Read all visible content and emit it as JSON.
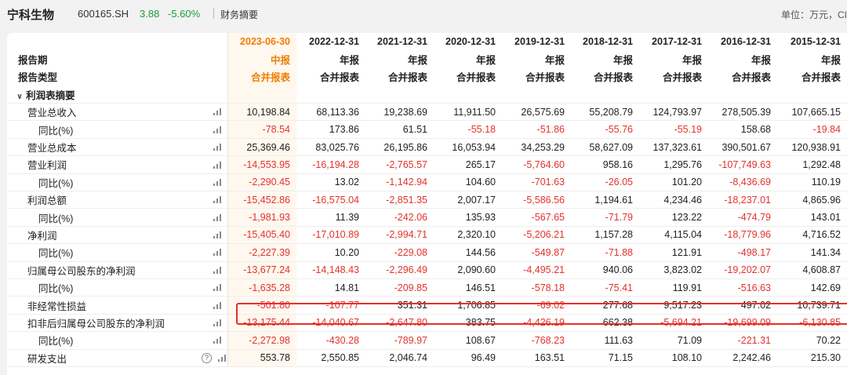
{
  "header": {
    "stock_name": "宁科生物",
    "stock_code": "600165.SH",
    "price": "3.88",
    "change": "-5.60%",
    "section": "财务摘要",
    "unit": "单位：万元，CI"
  },
  "table": {
    "dates": [
      "2023-06-30",
      "2022-12-31",
      "2021-12-31",
      "2020-12-31",
      "2019-12-31",
      "2018-12-31",
      "2017-12-31",
      "2016-12-31",
      "2015-12-31"
    ],
    "period_label": "报告期",
    "type_label": "报告类型",
    "periods": [
      "中报",
      "年报",
      "年报",
      "年报",
      "年报",
      "年报",
      "年报",
      "年报",
      "年报"
    ],
    "types": [
      "合并报表",
      "合并报表",
      "合并报表",
      "合并报表",
      "合并报表",
      "合并报表",
      "合并报表",
      "合并报表",
      "合并报表"
    ],
    "group_label": "利润表摘要",
    "rows": [
      {
        "label": "营业总收入",
        "level": 1,
        "values": [
          "10,198.84",
          "68,113.36",
          "19,238.69",
          "11,911.50",
          "26,575.69",
          "55,208.79",
          "124,793.97",
          "278,505.39",
          "107,665.15"
        ]
      },
      {
        "label": "同比(%)",
        "level": 2,
        "values": [
          "-78.54",
          "173.86",
          "61.51",
          "-55.18",
          "-51.86",
          "-55.76",
          "-55.19",
          "158.68",
          "-19.84"
        ]
      },
      {
        "label": "营业总成本",
        "level": 1,
        "values": [
          "25,369.46",
          "83,025.76",
          "26,195.86",
          "16,053.94",
          "34,253.29",
          "58,627.09",
          "137,323.61",
          "390,501.67",
          "120,938.91"
        ]
      },
      {
        "label": "营业利润",
        "level": 1,
        "values": [
          "-14,553.95",
          "-16,194.28",
          "-2,765.57",
          "265.17",
          "-5,764.60",
          "958.16",
          "1,295.76",
          "-107,749.63",
          "1,292.48"
        ]
      },
      {
        "label": "同比(%)",
        "level": 2,
        "values": [
          "-2,290.45",
          "13.02",
          "-1,142.94",
          "104.60",
          "-701.63",
          "-26.05",
          "101.20",
          "-8,436.69",
          "110.19"
        ]
      },
      {
        "label": "利润总额",
        "level": 1,
        "values": [
          "-15,452.86",
          "-16,575.04",
          "-2,851.35",
          "2,007.17",
          "-5,586.56",
          "1,194.61",
          "4,234.46",
          "-18,237.01",
          "4,865.96"
        ]
      },
      {
        "label": "同比(%)",
        "level": 2,
        "values": [
          "-1,981.93",
          "11.39",
          "-242.06",
          "135.93",
          "-567.65",
          "-71.79",
          "123.22",
          "-474.79",
          "143.01"
        ]
      },
      {
        "label": "净利润",
        "level": 1,
        "values": [
          "-15,405.40",
          "-17,010.89",
          "-2,994.71",
          "2,320.10",
          "-5,206.21",
          "1,157.28",
          "4,115.04",
          "-18,779.96",
          "4,716.52"
        ]
      },
      {
        "label": "同比(%)",
        "level": 2,
        "values": [
          "-2,227.39",
          "10.20",
          "-229.08",
          "144.56",
          "-549.87",
          "-71.88",
          "121.91",
          "-498.17",
          "141.34"
        ]
      },
      {
        "label": "归属母公司股东的净利润",
        "level": 1,
        "values": [
          "-13,677.24",
          "-14,148.43",
          "-2,296.49",
          "2,090.60",
          "-4,495.21",
          "940.06",
          "3,823.02",
          "-19,202.07",
          "4,608.87"
        ]
      },
      {
        "label": "同比(%)",
        "level": 2,
        "values": [
          "-1,635.28",
          "14.81",
          "-209.85",
          "146.51",
          "-578.18",
          "-75.41",
          "119.91",
          "-516.63",
          "142.69"
        ]
      },
      {
        "label": "非经常性损益",
        "level": 1,
        "values": [
          "-501.80",
          "-107.77",
          "351.31",
          "1,706.85",
          "-69.02",
          "277.68",
          "9,517.23",
          "497.02",
          "10,739.71"
        ]
      },
      {
        "label": "扣非后归属母公司股东的净利润",
        "level": 1,
        "values": [
          "-13,175.44",
          "-14,040.67",
          "-2,647.80",
          "383.75",
          "-4,426.19",
          "662.38",
          "-5,694.21",
          "-19,699.09",
          "-6,130.85"
        ]
      },
      {
        "label": "同比(%)",
        "level": 2,
        "values": [
          "-2,272.98",
          "-430.28",
          "-789.97",
          "108.67",
          "-768.23",
          "111.63",
          "71.09",
          "-221.31",
          "70.22"
        ]
      },
      {
        "label": "研发支出",
        "level": 1,
        "help": "?",
        "values": [
          "553.78",
          "2,550.85",
          "2,046.74",
          "96.49",
          "163.51",
          "71.15",
          "108.10",
          "2,242.46",
          "215.30"
        ]
      }
    ]
  },
  "colors": {
    "negative": "#e2332c",
    "positive": "#1a9d3f",
    "highlight": "#f07d00",
    "box": "#e5302a"
  },
  "icons": {
    "chart": "bar-chart-icon",
    "help": "question-icon",
    "collapse": "chevron-down-icon"
  }
}
